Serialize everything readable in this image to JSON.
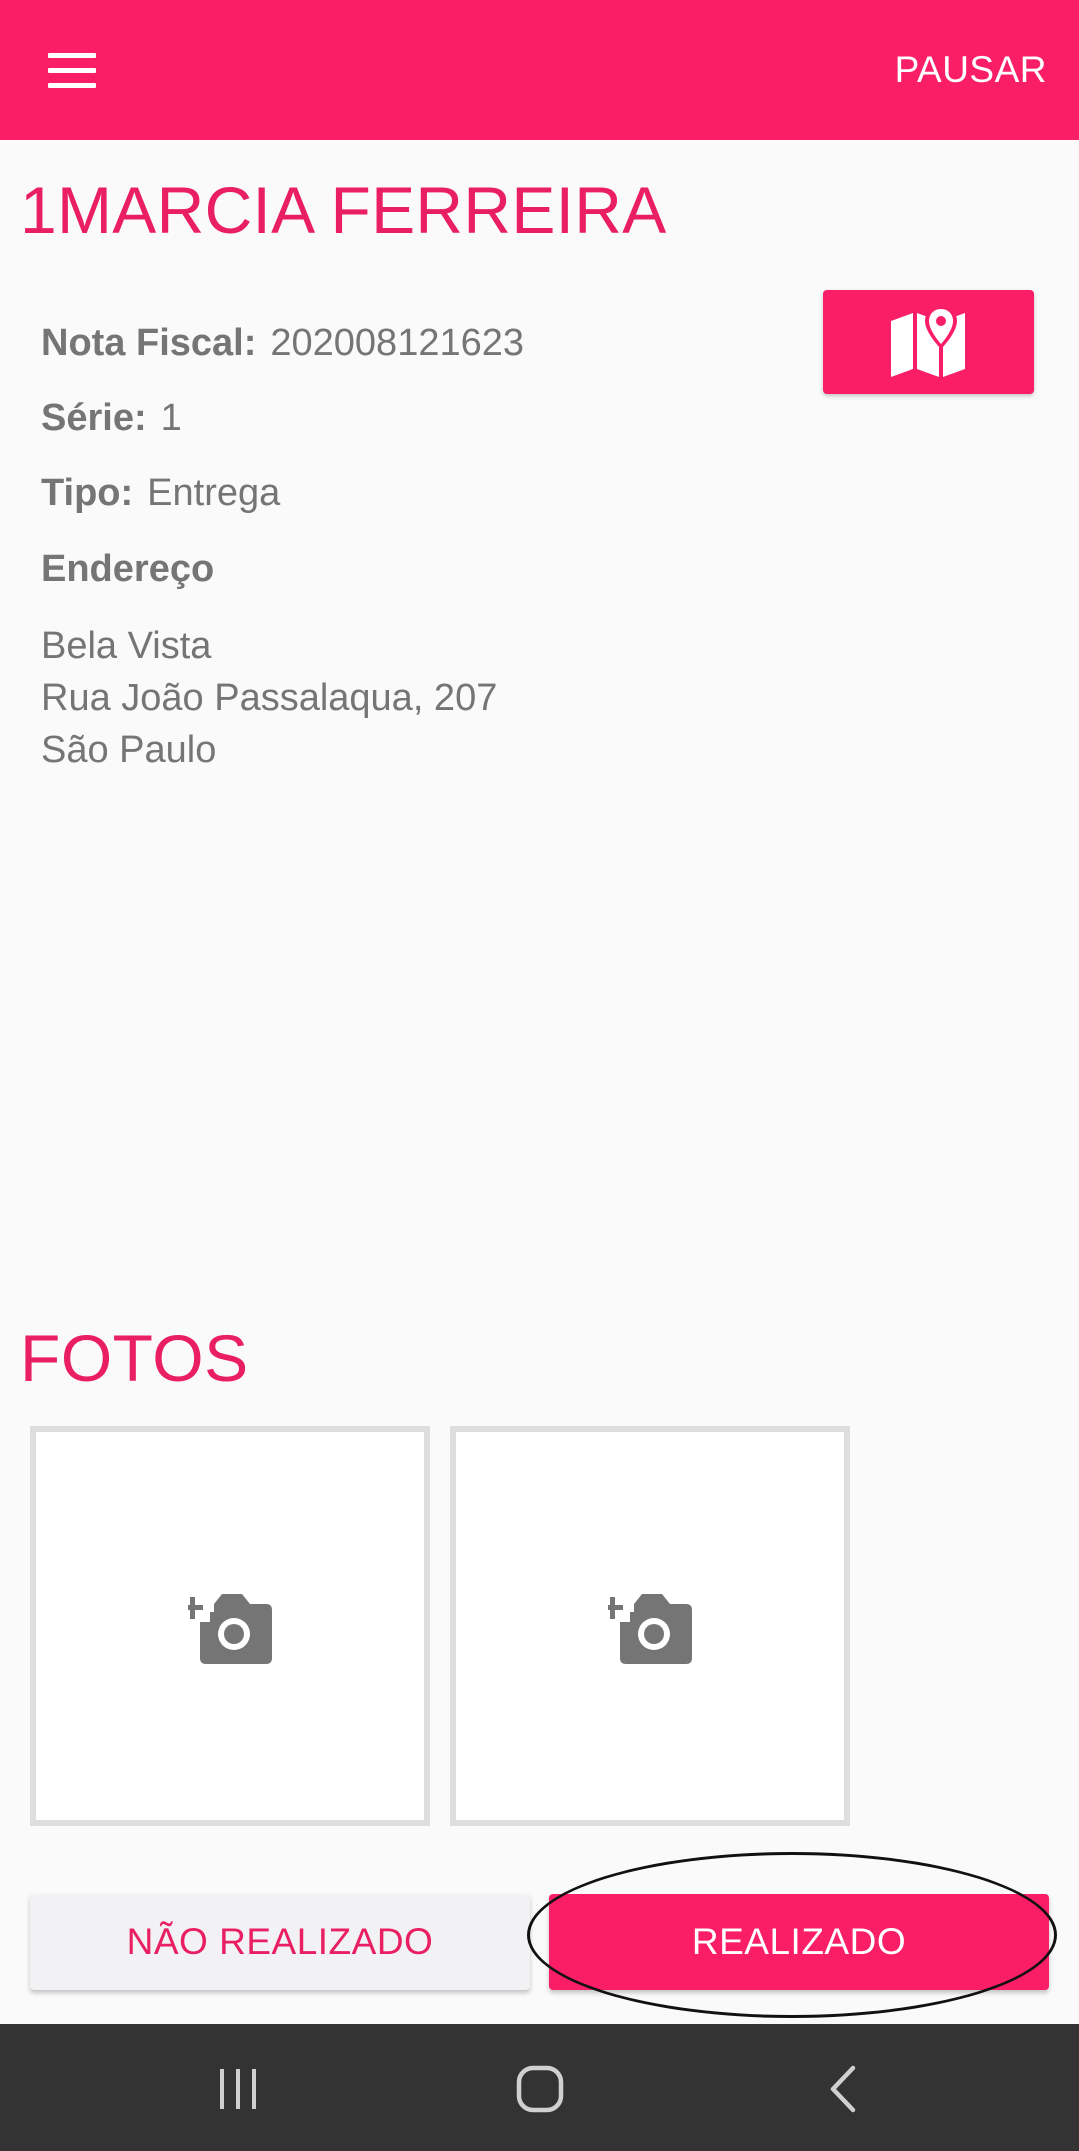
{
  "app_bar": {
    "menu_icon": "hamburger-menu-icon",
    "pause_label": "PAUSAR"
  },
  "delivery": {
    "customer_name": "1MARCIA FERREIRA",
    "map_icon": "map-icon",
    "nota_fiscal_label": "Nota Fiscal:",
    "nota_fiscal_value": "202008121623",
    "serie_label": "Série:",
    "serie_value": "1",
    "tipo_label": "Tipo:",
    "tipo_value": "Entrega",
    "endereco_label": "Endereço",
    "address_lines": [
      "Bela Vista",
      "Rua João Passalaqua, 207",
      "São Paulo"
    ]
  },
  "photos": {
    "title": "FOTOS",
    "slot_icon": "add-photo-camera-icon"
  },
  "actions": {
    "not_done_label": "NÃO REALIZADO",
    "done_label": "REALIZADO"
  },
  "system_nav": {
    "recents_icon": "recents-icon",
    "home_icon": "home-icon",
    "back_icon": "back-icon"
  },
  "colors": {
    "accent": "#f91e66",
    "title_text": "#e91e63",
    "body_text": "#757575",
    "nav_bar": "#333333"
  }
}
